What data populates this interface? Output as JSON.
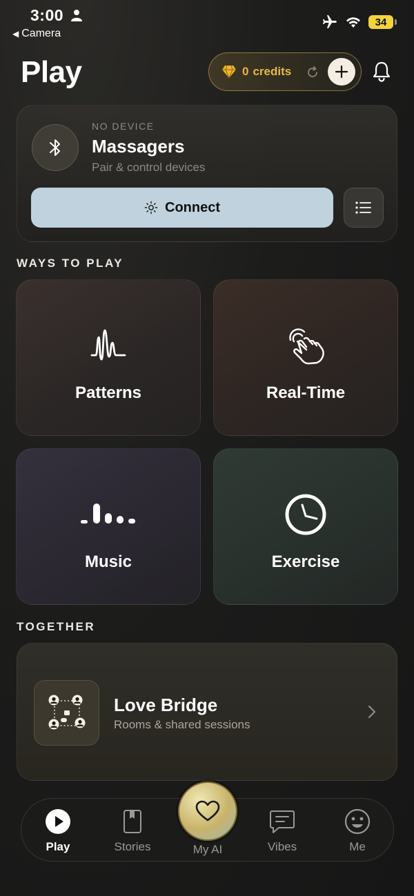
{
  "status_bar": {
    "time": "3:00",
    "back_label": "Camera",
    "battery": "34"
  },
  "header": {
    "title": "Play",
    "credits_count": "0",
    "credits_label": "credits"
  },
  "device_card": {
    "status": "NO DEVICE",
    "title": "Massagers",
    "subtitle": "Pair & control devices",
    "connect_label": "Connect"
  },
  "ways_to_play": {
    "heading": "WAYS TO PLAY",
    "tiles": [
      {
        "label": "Patterns",
        "icon": "waveform-icon"
      },
      {
        "label": "Real-Time",
        "icon": "touch-hand-icon"
      },
      {
        "label": "Music",
        "icon": "equalizer-icon"
      },
      {
        "label": "Exercise",
        "icon": "clock-icon"
      }
    ]
  },
  "together": {
    "heading": "TOGETHER",
    "title": "Love Bridge",
    "subtitle": "Rooms & shared sessions"
  },
  "tab_bar": {
    "tabs": [
      {
        "label": "Play",
        "icon": "play-icon",
        "active": true
      },
      {
        "label": "Stories",
        "icon": "book-icon",
        "active": false
      },
      {
        "label": "My AI",
        "icon": "heart-icon",
        "active": false
      },
      {
        "label": "Vibes",
        "icon": "chat-icon",
        "active": false
      },
      {
        "label": "Me",
        "icon": "smiley-icon",
        "active": false
      }
    ]
  },
  "colors": {
    "accent_gold": "#f0b62e",
    "connect_bg": "#bfd2dd",
    "battery": "#f2d33d"
  }
}
